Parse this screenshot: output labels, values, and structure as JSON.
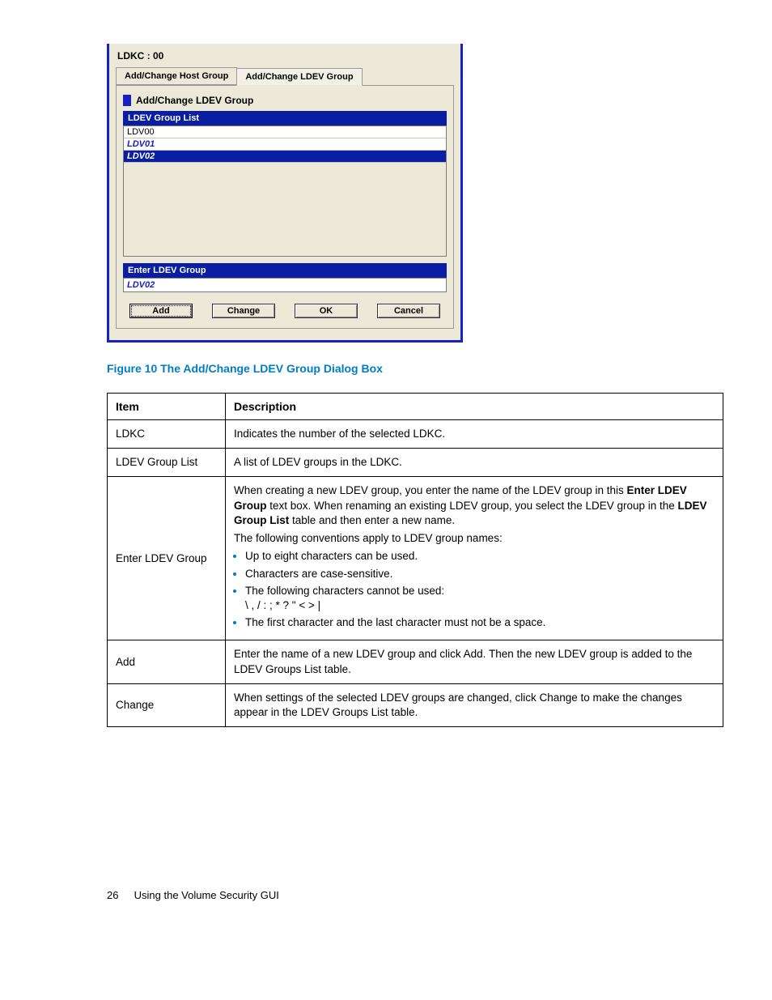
{
  "dialog": {
    "title": "LDKC : 00",
    "tabs": {
      "host": "Add/Change Host Group",
      "ldev": "Add/Change LDEV Group"
    },
    "section_title": "Add/Change LDEV Group",
    "list_header": "LDEV Group List",
    "list_items": [
      "LDV00",
      "LDV01",
      "LDV02"
    ],
    "enter_header": "Enter LDEV Group",
    "enter_value": "LDV02",
    "buttons": {
      "add": "Add",
      "change": "Change",
      "ok": "OK",
      "cancel": "Cancel"
    }
  },
  "figure_caption": "Figure 10 The Add/Change LDEV Group Dialog Box",
  "table": {
    "headers": {
      "item": "Item",
      "desc": "Description"
    },
    "rows": {
      "ldkc": {
        "item": "LDKC",
        "desc": "Indicates the number of the selected LDKC."
      },
      "list": {
        "item": "LDEV Group List",
        "desc": "A list of LDEV groups in the LDKC."
      },
      "enter": {
        "item": "Enter LDEV Group",
        "p1a": "When creating a new LDEV group, you enter the name of the LDEV group in this ",
        "p1b": "Enter LDEV Group",
        "p1c": " text box. When renaming an existing LDEV group, you select the LDEV group in the ",
        "p1d": "LDEV Group List",
        "p1e": " table and then enter a new name.",
        "p2": "The following conventions apply to LDEV group names:",
        "b1": "Up to eight characters can be used.",
        "b2": "Characters are case-sensitive.",
        "b3": "The following characters cannot be used:",
        "chars": "\\ , / : ; * ? \" < > |",
        "b4": "The first character and the last character must not be a space."
      },
      "add": {
        "item": "Add",
        "desc": "Enter the name of a new LDEV group and click Add. Then the new LDEV group is added to the LDEV Groups List table."
      },
      "change": {
        "item": "Change",
        "desc": "When settings of the selected LDEV groups are changed, click Change to make the changes appear in the LDEV Groups List table."
      }
    }
  },
  "footer": {
    "page": "26",
    "text": "Using the Volume Security GUI"
  }
}
